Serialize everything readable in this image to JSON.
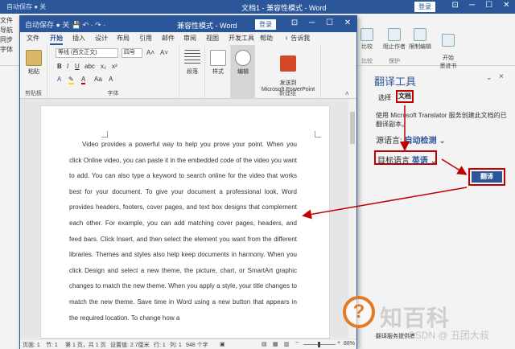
{
  "back_window": {
    "quick_access": "自动保存 ● 关",
    "title": "文档1 - 兼容性模式 - Word",
    "login": "登录",
    "left_tabs": [
      "文件",
      "导航",
      "同步",
      "字体"
    ],
    "groups": [
      {
        "label": "比较",
        "cap": "比较"
      },
      {
        "label": "阻止作者",
        "cap": "保护"
      },
      {
        "label": "限制编辑",
        "cap": ""
      },
      {
        "label": "开始\n墨迹书写",
        "cap": "墨迹"
      }
    ]
  },
  "pane": {
    "title": "翻译工具",
    "close_hint": "⌄",
    "close": "×",
    "tab_select": "选择",
    "tab_document": "文档",
    "description": "使用 Microsoft Translator 服务创建此文档的已翻译副本。",
    "source_label": "源语言:",
    "source_value": "自动检测",
    "target_label": "目标语言",
    "target_value": "英语",
    "translate_button": "翻译",
    "footer": "翻译服务提供者"
  },
  "front_window": {
    "quick_access": "自动保存 ● 关  💾  ↶ · ↷ ·",
    "title": "兼容性模式 - Word",
    "login": "登录",
    "tabs": [
      "文件",
      "开始",
      "插入",
      "设计",
      "布局",
      "引用",
      "邮件",
      "审阅",
      "视图",
      "开发工具",
      "帮助",
      "♀ 告诉我"
    ],
    "active_tab": "开始",
    "ribbon": {
      "paste": "粘贴",
      "clipboard_cap": "剪贴板",
      "font_name": "等线 (西文正文)",
      "font_size": "四号",
      "font_cap": "字体",
      "paragraph": "段落",
      "styles": "样式",
      "editing": "编辑",
      "send": "发送到\nMicrosoft PowerPoint",
      "send_cap": "新建组"
    },
    "doc_text": "Video provides a powerful way to help you prove your point. When you click Online video, you can paste it in the embedded code of the video you want to add. You can also type a keyword to search online for the video that works best for your document. To give your document a professional look, Word provides headers, footers, cover pages, and text box designs that complement each other. For example, you can add matching cover pages, headers, and feed bars. Click Insert, and then select the element you want from the different libraries. Themes and styles also help keep documents in harmony. When you click Design and select a new theme, the picture, chart, or SmartArt graphic changes to match the new theme. When you apply a style, your title changes to match the new theme. Save time in Word using a new button that appears in the required location. To change how a",
    "status": {
      "page": "页面: 1",
      "section": "节: 1",
      "pages": "第 1 页，共 1 页",
      "position": "设置值: 2.7厘米",
      "line": "行: 1",
      "column": "列: 1",
      "words": "948 个字",
      "zoom": "88%"
    }
  },
  "watermark": {
    "logo": "?",
    "text": "知百科",
    "small": "CSDN @ 丑团大叔"
  },
  "colors": {
    "word_blue": "#2b579a",
    "highlight_red": "#c00000",
    "watermark_orange": "#e37a25"
  }
}
